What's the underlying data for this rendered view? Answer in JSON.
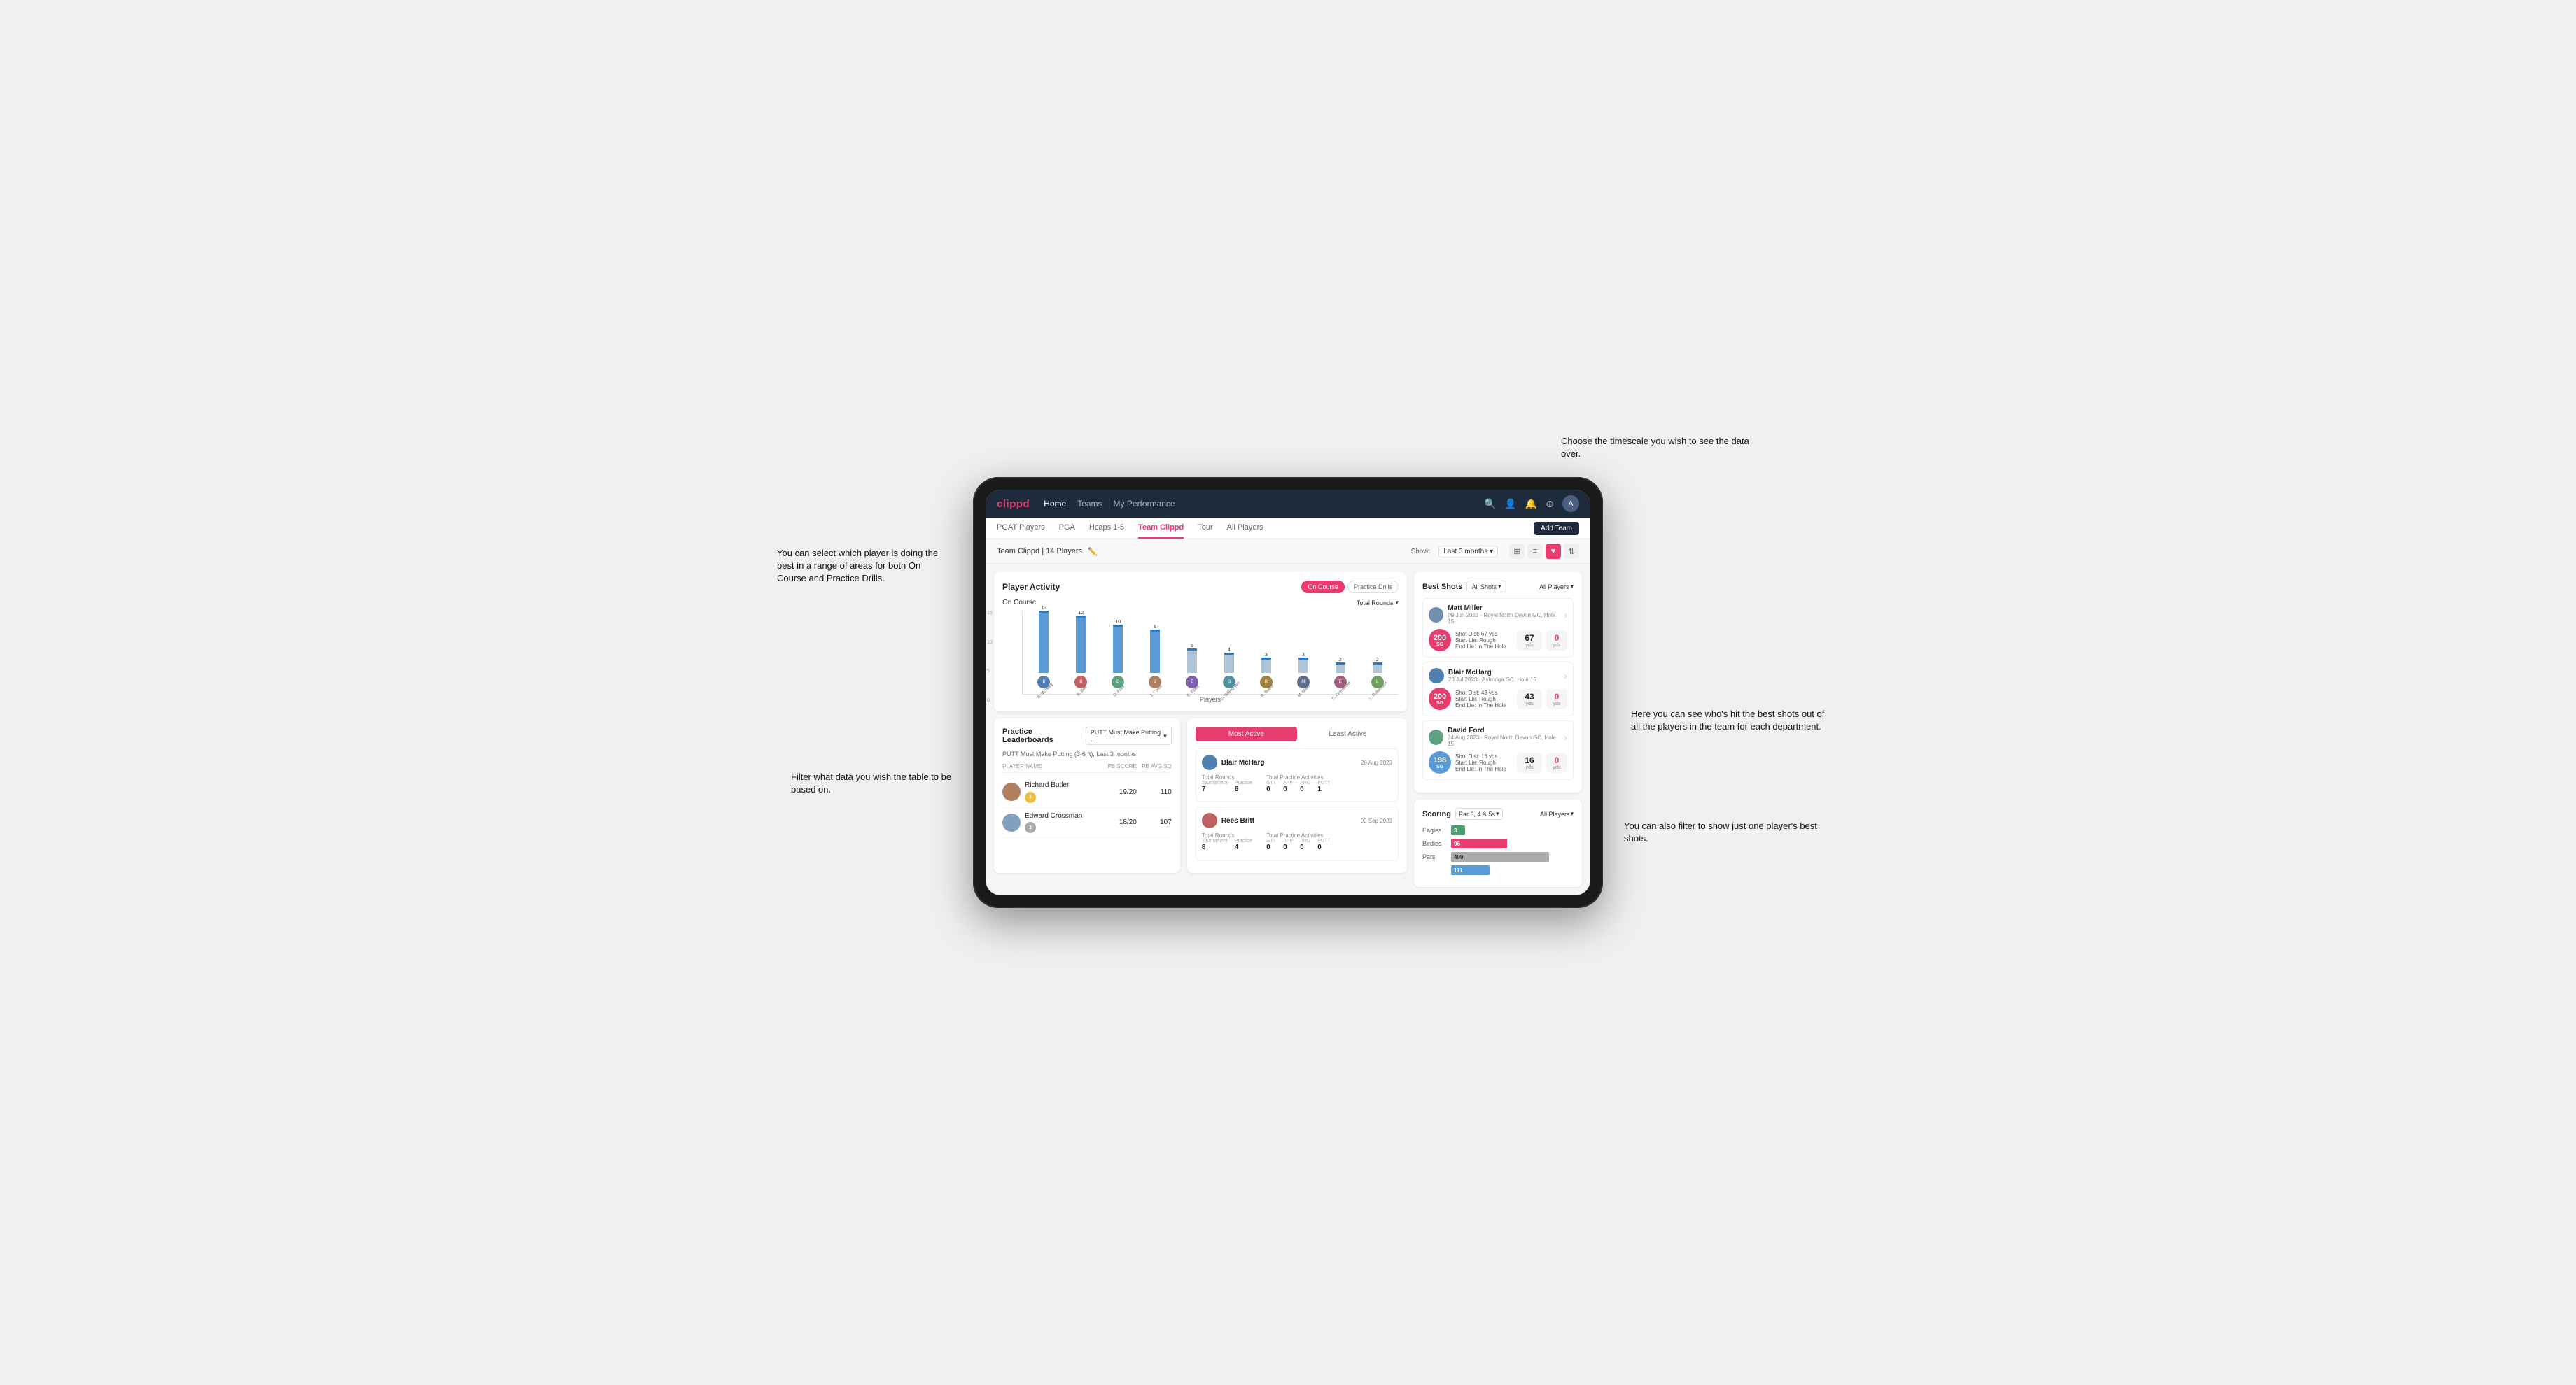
{
  "annotations": {
    "top_right": "Choose the timescale you wish to see the data over.",
    "left_1": "You can select which player is doing the best in a range of areas for both On Course and Practice Drills.",
    "left_2": "Filter what data you wish the table to be based on.",
    "right_1": "Here you can see who's hit the best shots out of all the players in the team for each department.",
    "right_2": "You can also filter to show just one player's best shots."
  },
  "nav": {
    "logo": "clippd",
    "links": [
      "Home",
      "Teams",
      "My Performance"
    ],
    "icons": [
      "search",
      "users",
      "bell",
      "plus",
      "avatar"
    ]
  },
  "sub_tabs": [
    "PGAT Players",
    "PGA",
    "Hcaps 1-5",
    "Team Clippd",
    "Tour",
    "All Players"
  ],
  "active_sub_tab": "Team Clippd",
  "add_team_btn": "Add Team",
  "team_header": {
    "name": "Team Clippd | 14 Players",
    "show_label": "Show:",
    "show_value": "Last 3 months",
    "view_modes": [
      "grid",
      "list",
      "heart",
      "sort"
    ]
  },
  "player_activity": {
    "title": "Player Activity",
    "toggle_on_course": "On Course",
    "toggle_practice": "Practice Drills",
    "section_title": "On Course",
    "chart_dropdown": "Total Rounds",
    "players_label": "Players",
    "y_labels": [
      "15",
      "10",
      "5",
      "0"
    ],
    "bars": [
      {
        "name": "B. McHarg",
        "value": 13,
        "pct": 87
      },
      {
        "name": "B. Britt",
        "value": 12,
        "pct": 80
      },
      {
        "name": "D. Ford",
        "value": 10,
        "pct": 67
      },
      {
        "name": "J. Coles",
        "value": 9,
        "pct": 60
      },
      {
        "name": "E. Ebert",
        "value": 5,
        "pct": 33
      },
      {
        "name": "G. Billingham",
        "value": 4,
        "pct": 27
      },
      {
        "name": "R. Butler",
        "value": 3,
        "pct": 20
      },
      {
        "name": "M. Miller",
        "value": 3,
        "pct": 20
      },
      {
        "name": "E. Crossman",
        "value": 2,
        "pct": 13
      },
      {
        "name": "L. Robertson",
        "value": 2,
        "pct": 13
      }
    ]
  },
  "best_shots": {
    "title": "Best Shots",
    "filter_all": "All Shots",
    "filter_all_players": "All Players",
    "players": [
      {
        "name": "Matt Miller",
        "date": "09 Jun 2023",
        "course": "Royal North Devon GC",
        "hole": "Hole 15",
        "badge_num": "200",
        "badge_label": "SG",
        "shot_dist_text": "Shot Dist: 67 yds\nStart Lie: Rough\nEnd Lie: In The Hole",
        "dist_val": "67",
        "dist_unit": "yds",
        "zero_val": "0",
        "zero_unit": "yds"
      },
      {
        "name": "Blair McHarg",
        "date": "23 Jul 2023",
        "course": "Ashridge GC",
        "hole": "Hole 15",
        "badge_num": "200",
        "badge_label": "SG",
        "shot_dist_text": "Shot Dist: 43 yds\nStart Lie: Rough\nEnd Lie: In The Hole",
        "dist_val": "43",
        "dist_unit": "yds",
        "zero_val": "0",
        "zero_unit": "yds"
      },
      {
        "name": "David Ford",
        "date": "24 Aug 2023",
        "course": "Royal North Devon GC",
        "hole": "Hole 15",
        "badge_num": "198",
        "badge_label": "SG",
        "shot_dist_text": "Shot Dist: 16 yds\nStart Lie: Rough\nEnd Lie: In The Hole",
        "dist_val": "16",
        "dist_unit": "yds",
        "zero_val": "0",
        "zero_unit": "yds"
      }
    ]
  },
  "practice_leaderboards": {
    "title": "Practice Leaderboards",
    "select_label": "PUTT Must Make Putting ...",
    "subtitle": "PUTT Must Make Putting (3-6 ft), Last 3 months",
    "col_name": "PLAYER NAME",
    "col_pb": "PB SCORE",
    "col_avg": "PB AVG SQ",
    "players": [
      {
        "rank": 1,
        "name": "Richard Butler",
        "badge_type": "gold",
        "badge_num": "1",
        "pb_score": "19/20",
        "pb_avg": "110"
      },
      {
        "rank": 2,
        "name": "Edward Crossman",
        "badge_type": "silver",
        "badge_num": "2",
        "pb_score": "18/20",
        "pb_avg": "107"
      }
    ]
  },
  "most_active": {
    "tab_most": "Most Active",
    "tab_least": "Least Active",
    "players": [
      {
        "name": "Blair McHarg",
        "date": "26 Aug 2023",
        "total_rounds_label": "Total Rounds",
        "tournament_label": "Tournament",
        "practice_label": "Practice",
        "tournament_val": "7",
        "practice_val": "6",
        "total_practice_label": "Total Practice Activities",
        "gtt_label": "GTT",
        "app_label": "APP",
        "arg_label": "ARG",
        "putt_label": "PUTT",
        "gtt_val": "0",
        "app_val": "0",
        "arg_val": "0",
        "putt_val": "1"
      },
      {
        "name": "Rees Britt",
        "date": "02 Sep 2023",
        "total_rounds_label": "Total Rounds",
        "tournament_label": "Tournament",
        "practice_label": "Practice",
        "tournament_val": "8",
        "practice_val": "4",
        "total_practice_label": "Total Practice Activities",
        "gtt_label": "GTT",
        "app_label": "APP",
        "arg_label": "ARG",
        "putt_label": "PUTT",
        "gtt_val": "0",
        "app_val": "0",
        "arg_val": "0",
        "putt_val": "0"
      }
    ]
  },
  "scoring": {
    "title": "Scoring",
    "filter_label": "Par 3, 4 & 5s",
    "players_label": "All Players",
    "bars": [
      {
        "label": "Eagles",
        "value": 3,
        "color": "#4a9e6e",
        "width": 12
      },
      {
        "label": "Birdies",
        "value": 96,
        "color": "#e83c6e",
        "width": 80
      },
      {
        "label": "Pars",
        "value": 499,
        "color": "#888",
        "width": 140
      },
      {
        "label": "???",
        "value": 111,
        "color": "#5b9bd5",
        "width": 50
      }
    ]
  },
  "colors": {
    "brand_red": "#e83c6e",
    "nav_bg": "#1e2b3c",
    "bar_default": "#b0c4d8",
    "bar_highlight": "#5b9bd5"
  }
}
